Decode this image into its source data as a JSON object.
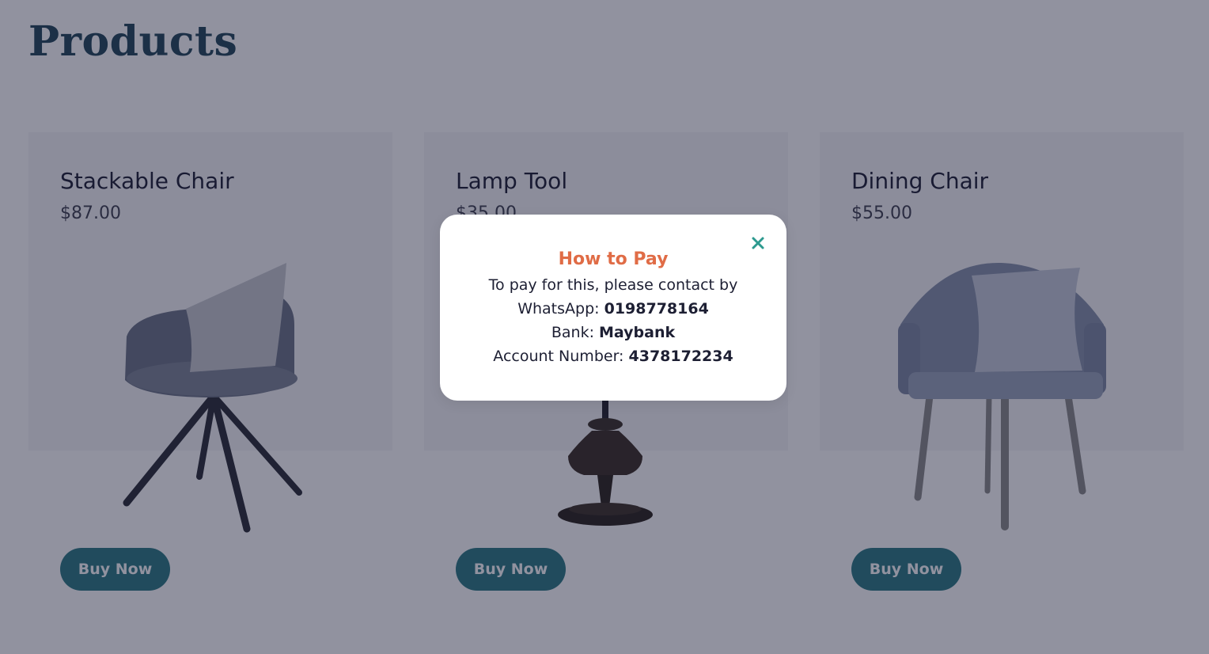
{
  "page": {
    "title": "Products"
  },
  "products": [
    {
      "name": "Stackable Chair",
      "price": "$87.00",
      "image_icon": "gray-armchair-image",
      "button_label": "Buy Now"
    },
    {
      "name": "Lamp Tool",
      "price": "$35.00",
      "image_icon": "black-lamp-base-image",
      "button_label": "Buy Now"
    },
    {
      "name": "Dining Chair",
      "price": "$55.00",
      "image_icon": "blue-gray-chair-image",
      "button_label": "Buy Now"
    }
  ],
  "modal": {
    "title": "How to Pay",
    "intro": "To pay for this, please contact by",
    "whatsapp_label": "WhatsApp:",
    "whatsapp_value": "0198778164",
    "bank_label": "Bank:",
    "bank_value": "Maybank",
    "account_label": "Account Number:",
    "account_value": "4378172234",
    "close_icon": "close-icon"
  },
  "colors": {
    "title": "#23475a",
    "button": "#2d7a83",
    "modal_title": "#e06c46",
    "close": "#2d9a8f",
    "overlay": "rgba(22,24,50,0.47)"
  }
}
